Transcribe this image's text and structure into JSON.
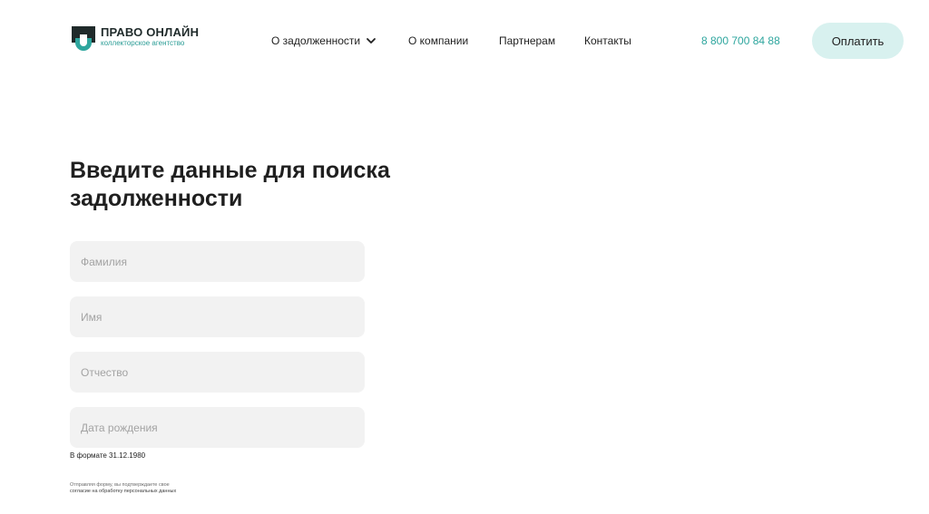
{
  "header": {
    "logo": {
      "title": "ПРАВО ОНЛАЙН",
      "subtitle": "коллекторское агентство",
      "colors": {
        "dark": "#1f2a2a",
        "accent": "#2ea69e"
      }
    },
    "nav": [
      {
        "label": "О задолженности",
        "has_dropdown": true,
        "icon": "chevron-down-icon"
      },
      {
        "label": "О компании"
      },
      {
        "label": "Партнерам"
      },
      {
        "label": "Контакты"
      }
    ],
    "phone": "8 800 700 84 88",
    "pay_button": "Оплатить"
  },
  "form": {
    "title": "Введите данные для поиска задолженности",
    "fields": {
      "last_name": {
        "placeholder": "Фамилия",
        "value": ""
      },
      "first_name": {
        "placeholder": "Имя",
        "value": ""
      },
      "patronymic": {
        "placeholder": "Отчество",
        "value": ""
      },
      "birth_date": {
        "placeholder": "Дата рождения",
        "value": ""
      }
    },
    "date_hint": "В формате 31.12.1980",
    "consent_line1": "Отправляя форму, вы подтверждаете свое",
    "consent_line2": "согласие на обработку персональных данных"
  },
  "colors": {
    "accent": "#2ea69e",
    "button_bg": "#d8f1ef",
    "field_bg": "#f2f2f2",
    "text": "#1f1f1f"
  }
}
